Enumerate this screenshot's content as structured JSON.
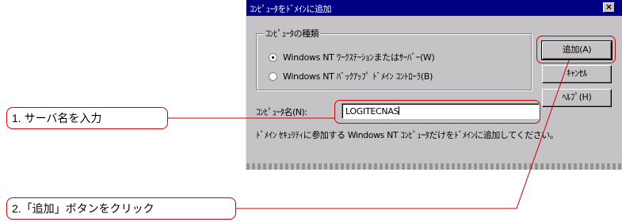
{
  "dialog": {
    "title": "ｺﾝﾋﾟｭｰﾀをﾄﾞﾒｲﾝに追加",
    "close_label": "×",
    "group_label": "ｺﾝﾋﾟｭｰﾀの種類",
    "radios": [
      {
        "label": "Windows NT ﾜｰｸｽﾃｰｼｮﾝまたはｻｰﾊﾞｰ(W)",
        "checked": true
      },
      {
        "label": "Windows NT ﾊﾞｯｸｱｯﾌﾟ ﾄﾞﾒｲﾝ ｺﾝﾄﾛｰﾗ(B)",
        "checked": false
      }
    ],
    "buttons": {
      "add": "追加(A)",
      "cancel": "ｷｬﾝｾﾙ",
      "help": "ﾍﾙﾌﾟ(H)"
    },
    "computer_name_label": "ｺﾝﾋﾟｭｰﾀ名(N):",
    "computer_name_value": "LOGITECNAS",
    "note": "ﾄﾞﾒｲﾝ ｾｷｭﾘﾃｨに参加する Windows NT ｺﾝﾋﾟｭｰﾀだけをﾄﾞﾒｲﾝに追加してください。"
  },
  "callouts": {
    "step1": "1. サーバ名を入力",
    "step2": "2.「追加」ボタンをクリック"
  },
  "colors": {
    "callout_red": "#d00000",
    "titlebar": "#000084",
    "dialog_face": "#c6c3c6"
  }
}
